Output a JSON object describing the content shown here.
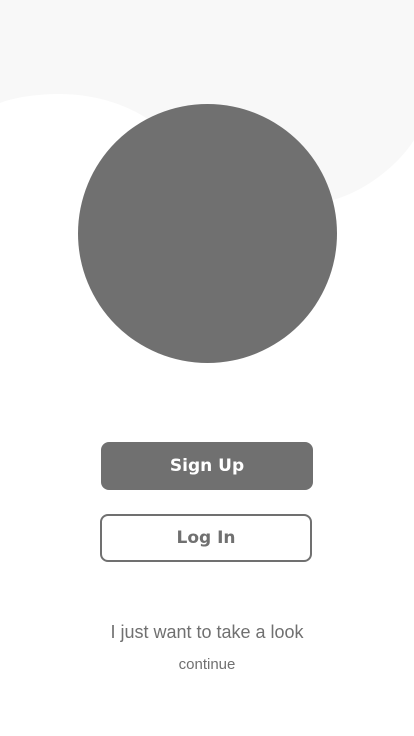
{
  "colors": {
    "primary_gray": "#707070",
    "background": "#ffffff",
    "background_blob": "#f8f8f8"
  },
  "hero": {
    "image_placeholder": "gray-circle"
  },
  "buttons": {
    "signup_label": "Sign Up",
    "login_label": "Log In"
  },
  "guest": {
    "prompt": "I just want to take a look",
    "continue_label": "continue"
  }
}
